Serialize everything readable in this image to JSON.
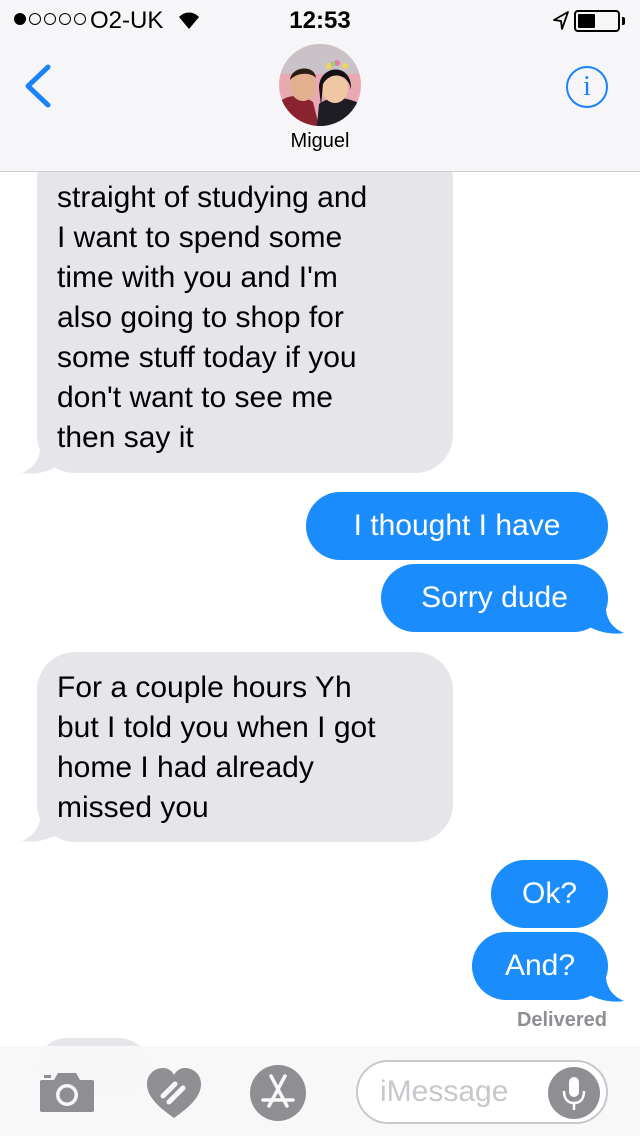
{
  "status_bar": {
    "carrier": "O2-UK",
    "time": "12:53",
    "signal_bars_filled": 1,
    "signal_bars_total": 5,
    "battery_level": 0.45
  },
  "header": {
    "contact_name": "Miguel",
    "back_icon": "chevron-left-icon",
    "info_label": "i"
  },
  "messages": [
    {
      "direction": "incoming",
      "lines": [
        "straight of studying and",
        "I want to spend some",
        "time with you and I'm",
        "also going to shop for",
        "some stuff today if you",
        "don't want to see me",
        "then say it"
      ]
    },
    {
      "direction": "outgoing",
      "lines": [
        "I thought I have"
      ]
    },
    {
      "direction": "outgoing",
      "lines": [
        "Sorry dude"
      ]
    },
    {
      "direction": "incoming",
      "lines": [
        "For a couple hours Yh",
        "but I told you when I got",
        "home I had already",
        "missed you"
      ]
    },
    {
      "direction": "outgoing",
      "lines": [
        "Ok?"
      ]
    },
    {
      "direction": "outgoing",
      "lines": [
        "And?"
      ]
    }
  ],
  "delivered_label": "Delivered",
  "input": {
    "placeholder": "iMessage"
  },
  "toolbar": {
    "camera_icon": "camera-icon",
    "digital_touch_icon": "digital-touch-heart-icon",
    "app_store_icon": "app-store-icon",
    "mic_icon": "microphone-icon"
  },
  "colors": {
    "accent": "#1a82fb",
    "outgoing_bubble": "#1a8cfb",
    "incoming_bubble": "#e5e5ea",
    "secondary_text": "#8e8e93"
  }
}
